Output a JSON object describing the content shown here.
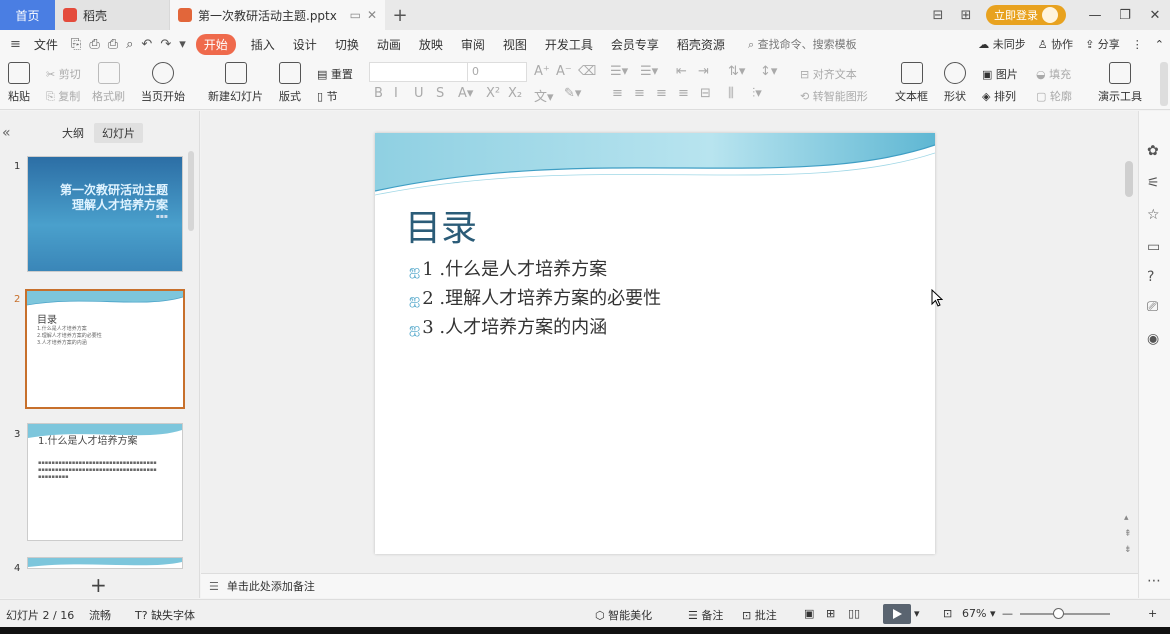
{
  "titlebar": {
    "home": "首页",
    "docer_tab": "稻壳",
    "doc_tab": "第一次教研活动主题.pptx",
    "login": "立即登录"
  },
  "menubar": {
    "file": "文件",
    "tabs": [
      "开始",
      "插入",
      "设计",
      "切换",
      "动画",
      "放映",
      "审阅",
      "视图",
      "开发工具",
      "会员专享",
      "稻壳资源"
    ],
    "search": "查找命令、搜索模板",
    "sync": "未同步",
    "collab": "协作",
    "share": "分享"
  },
  "ribbon": {
    "paste": "粘贴",
    "cut": "剪切",
    "copy": "复制",
    "format_painter": "格式刷",
    "from_current": "当页开始",
    "new_slide": "新建幻灯片",
    "layout": "版式",
    "reset": "重置",
    "section": "节",
    "font_size": "0",
    "align_text": "对齐文本",
    "smartart": "转智能图形",
    "textbox": "文本框",
    "shape": "形状",
    "picture": "图片",
    "arrange": "排列",
    "fill": "填充",
    "outline": "轮廓",
    "tools": "演示工具"
  },
  "leftpanel": {
    "outline_tab": "大纲",
    "slides_tab": "幻灯片",
    "slides": [
      {
        "num": "1",
        "title_line1": "第一次教研活动主题",
        "title_line2": "理解人才培养方案"
      },
      {
        "num": "2",
        "title": "目录",
        "lines": [
          "1.什么是人才培养方案",
          "2.理解人才培养方案的必要性",
          "3.人才培养方案的内涵"
        ]
      },
      {
        "num": "3",
        "title": "1.什么是人才培养方案"
      },
      {
        "num": "4"
      }
    ],
    "add": "+"
  },
  "slide": {
    "title": "目录",
    "items": [
      "1 .什么是人才培养方案",
      "2 .理解人才培养方案的必要性",
      "3 .人才培养方案的内涵"
    ]
  },
  "notes": {
    "placeholder": "单击此处添加备注"
  },
  "statusbar": {
    "slide_pos": "幻灯片 2 / 16",
    "mode": "流畅",
    "missing_font": "缺失字体",
    "beautify": "智能美化",
    "notes": "备注",
    "comments": "批注",
    "zoom": "67%"
  },
  "colors": {
    "accent": "#ef6a4c",
    "home_tab": "#4a7ee3",
    "title_text": "#2b5c78",
    "login": "#e8a21f"
  }
}
